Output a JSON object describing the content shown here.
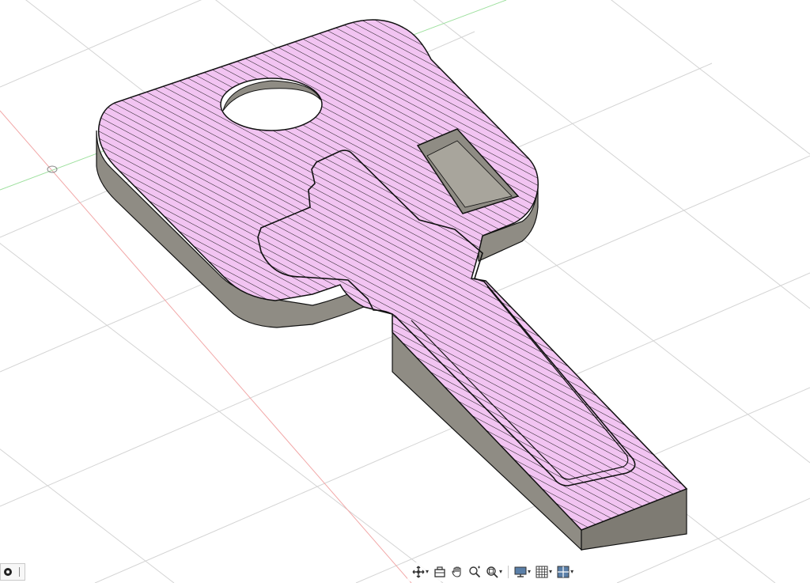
{
  "viewport": {
    "background": "#ffffff",
    "grid_color": "#d4d4d4",
    "x_axis_color": "#f2a8a8",
    "y_axis_color": "#9ee09e",
    "model": {
      "top_face_color": "#f2c4f2",
      "hatch_color": "#1a1a1a",
      "side_face_color": "#8f8c84",
      "edge_color": "#111111"
    }
  },
  "nav_toolbar": {
    "buttons": [
      {
        "name": "orbit",
        "icon": "orbit-icon",
        "has_menu": true
      },
      {
        "name": "look-at",
        "icon": "look-at-icon",
        "has_menu": false
      },
      {
        "name": "pan",
        "icon": "pan-hand-icon",
        "has_menu": false
      },
      {
        "name": "zoom",
        "icon": "zoom-icon",
        "has_menu": false
      },
      {
        "name": "fit",
        "icon": "zoom-fit-icon",
        "has_menu": true
      },
      {
        "name": "display-settings",
        "icon": "display-settings-icon",
        "has_menu": true
      },
      {
        "name": "grid-snaps",
        "icon": "grid-icon",
        "has_menu": true
      },
      {
        "name": "viewports",
        "icon": "viewports-icon",
        "has_menu": true
      }
    ]
  },
  "corner_widget": {
    "icon": "record-icon"
  }
}
